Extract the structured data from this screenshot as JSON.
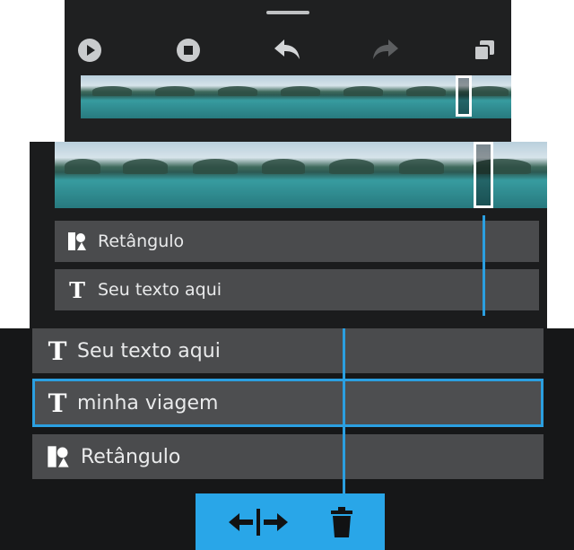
{
  "toolbar": {
    "icons": [
      "play-icon",
      "stop-icon",
      "undo-icon",
      "redo-icon",
      "copy-icon"
    ]
  },
  "tracks_back": [],
  "tracks_mid": [
    {
      "icon": "shapes-icon",
      "label": "Retângulo"
    },
    {
      "icon": "text-icon",
      "label": "Seu texto aqui"
    }
  ],
  "tracks_front": [
    {
      "icon": "text-icon",
      "label": "Seu texto aqui",
      "selected": false
    },
    {
      "icon": "text-icon",
      "label": "minha viagem",
      "selected": true
    },
    {
      "icon": "shapes-icon",
      "label": "Retângulo",
      "selected": false
    }
  ],
  "action_bar": {
    "icons": [
      "split-icon",
      "trash-icon"
    ]
  },
  "colors": {
    "accent": "#2b9fe0",
    "action_bar": "#29a6e8",
    "row_bg": "#4a4b4d",
    "panel_bg": "#161718"
  }
}
